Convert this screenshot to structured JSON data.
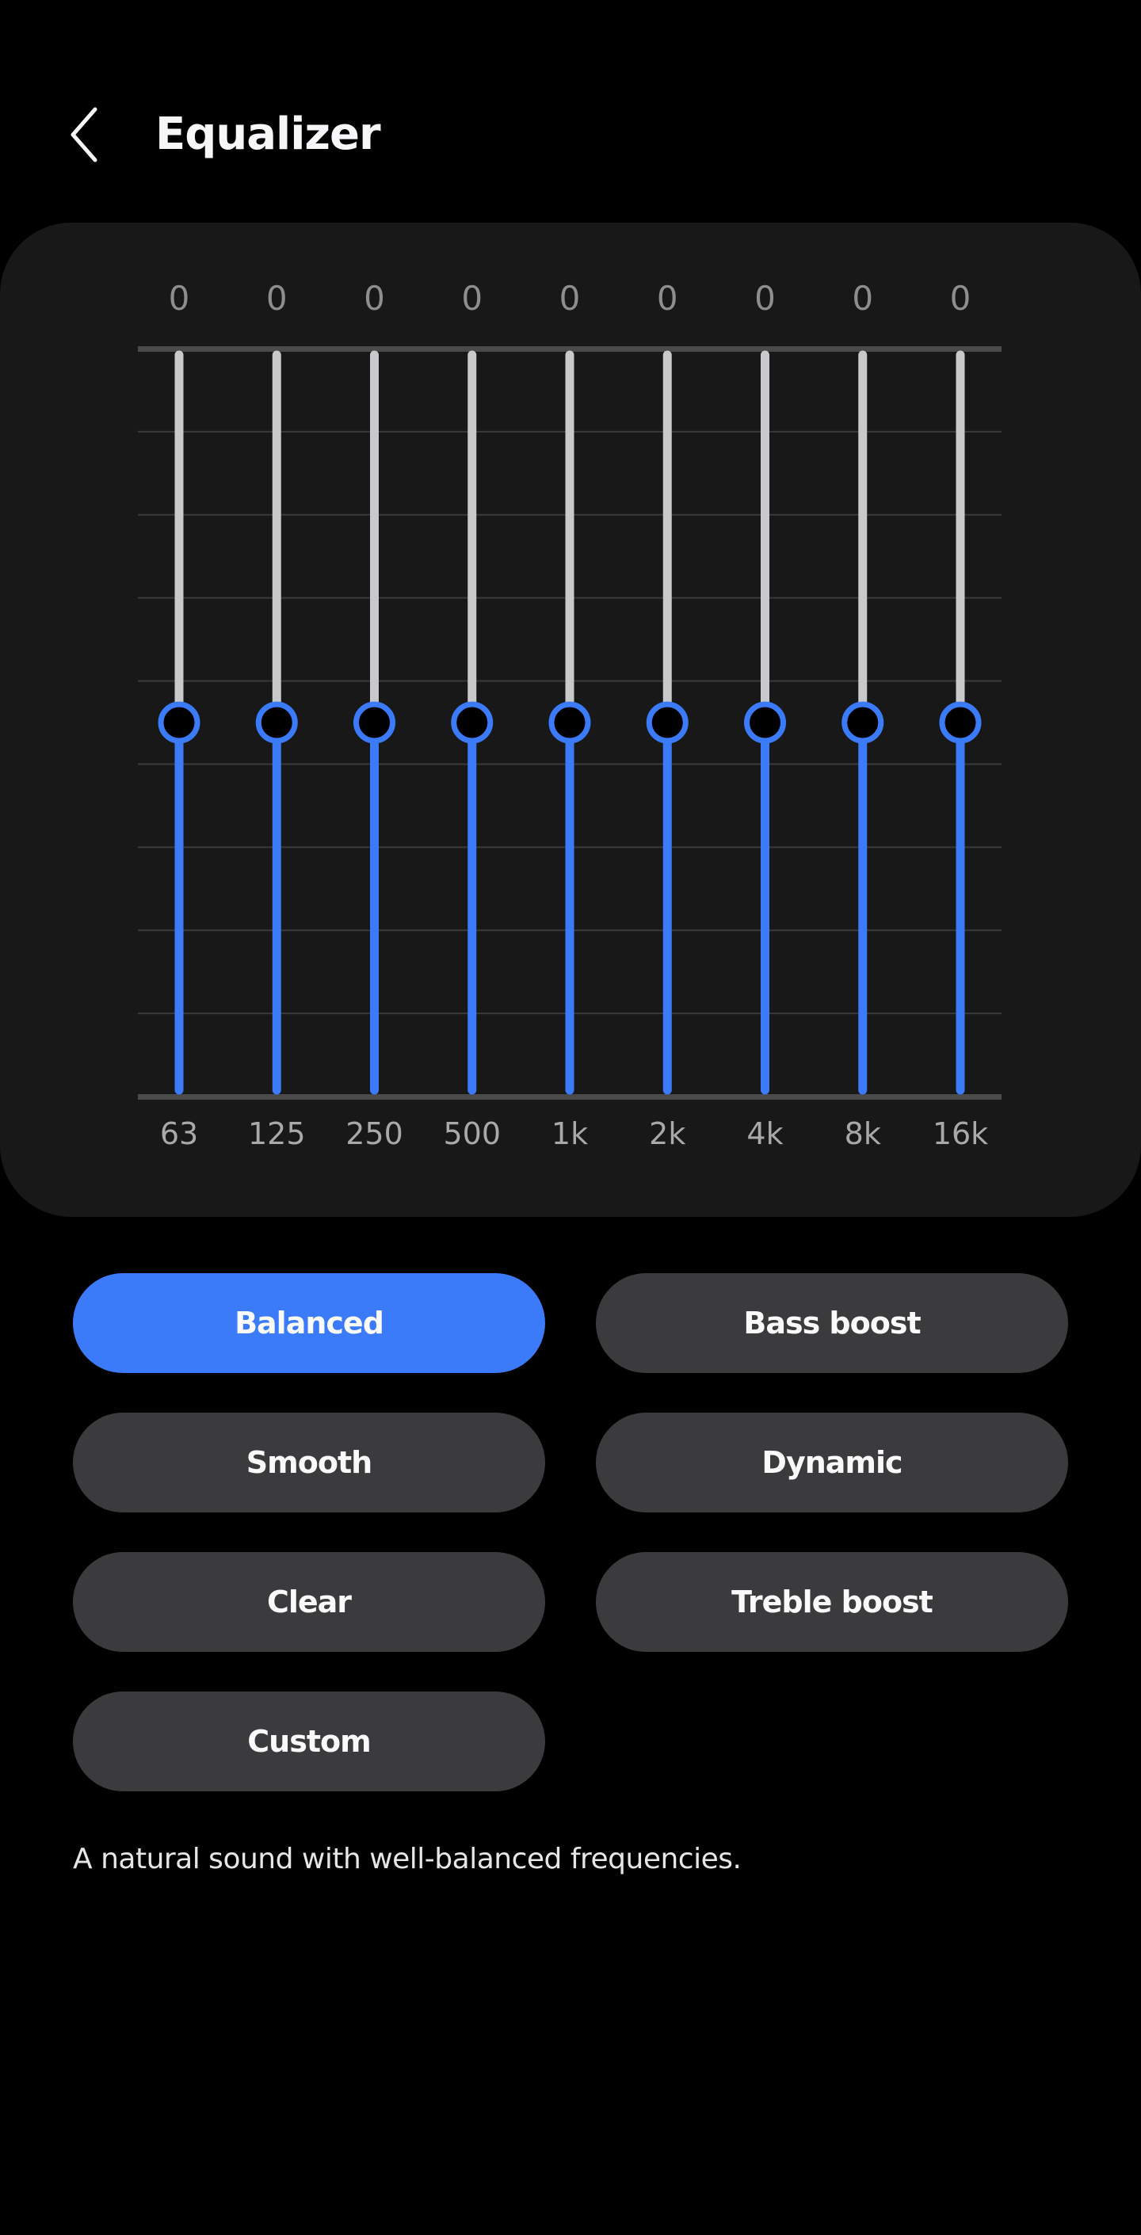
{
  "header": {
    "title": "Equalizer",
    "back_icon": "chevron-left-icon"
  },
  "colors": {
    "accent": "#3b7bfa",
    "track_upper": "#c9c9cb",
    "card_bg": "#181818",
    "button_bg": "#3b3b3d",
    "grid": "#3a3a3a",
    "axis": "#4a4a4a"
  },
  "chart_data": {
    "type": "bar",
    "title": "Equalizer",
    "categories": [
      "63",
      "125",
      "250",
      "500",
      "1k",
      "2k",
      "4k",
      "8k",
      "16k"
    ],
    "values": [
      0,
      0,
      0,
      0,
      0,
      0,
      0,
      0,
      0
    ],
    "value_labels": [
      "0",
      "0",
      "0",
      "0",
      "0",
      "0",
      "0",
      "0",
      "0"
    ],
    "xlabel": "",
    "ylabel": "",
    "ylim": [
      -10,
      10
    ],
    "gridlines": 9,
    "grid": true
  },
  "presets": [
    {
      "label": "Balanced",
      "selected": true
    },
    {
      "label": "Bass boost",
      "selected": false
    },
    {
      "label": "Smooth",
      "selected": false
    },
    {
      "label": "Dynamic",
      "selected": false
    },
    {
      "label": "Clear",
      "selected": false
    },
    {
      "label": "Treble boost",
      "selected": false
    },
    {
      "label": "Custom",
      "selected": false
    }
  ],
  "description": "A natural sound with well-balanced frequencies."
}
